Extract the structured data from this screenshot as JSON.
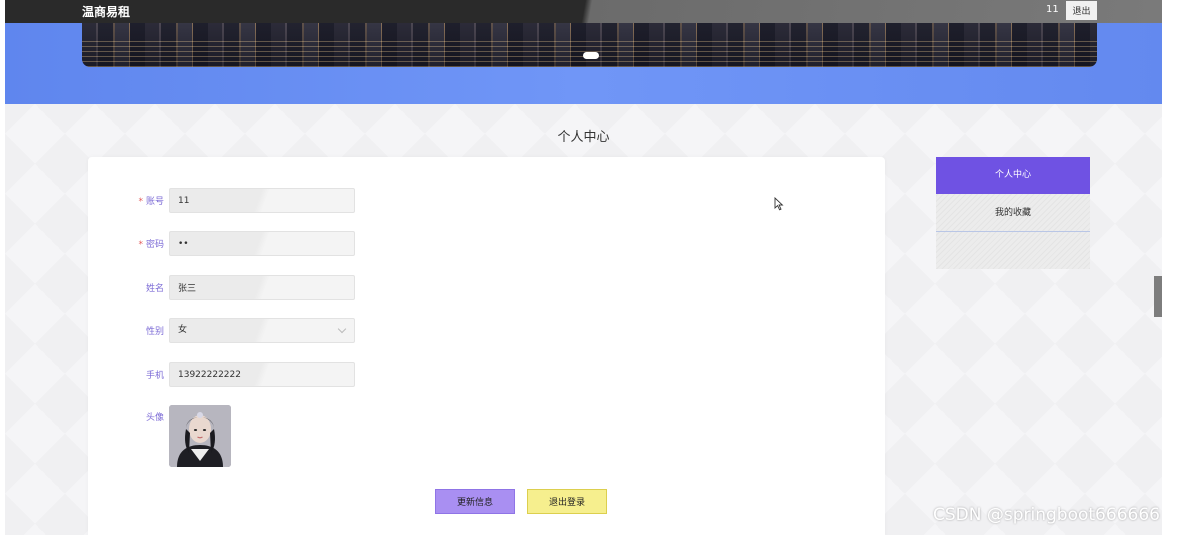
{
  "header": {
    "app_title": "温商易租",
    "username": "11",
    "logout_label": "退出"
  },
  "page": {
    "title": "个人中心"
  },
  "form": {
    "fields": [
      {
        "label": "账号",
        "required": true,
        "value": "11"
      },
      {
        "label": "密码",
        "required": true,
        "value": "••"
      },
      {
        "label": "姓名",
        "required": false,
        "value": "张三"
      },
      {
        "label": "性别",
        "required": false,
        "value": "女"
      },
      {
        "label": "手机",
        "required": false,
        "value": "13922222222"
      },
      {
        "label": "头像",
        "required": false
      }
    ],
    "update_button": "更新信息",
    "logout_button": "退出登录"
  },
  "sidebar": {
    "items": [
      {
        "label": "个人中心",
        "active": true
      },
      {
        "label": "我的收藏",
        "active": false
      }
    ]
  },
  "colors": {
    "accent": "#6f52e3",
    "header_band": "#6b8ff3",
    "update_button": "#a98ff2",
    "logout_button": "#f6ef8e",
    "label": "#7c6bd6"
  },
  "watermark": "CSDN @springboot666666"
}
